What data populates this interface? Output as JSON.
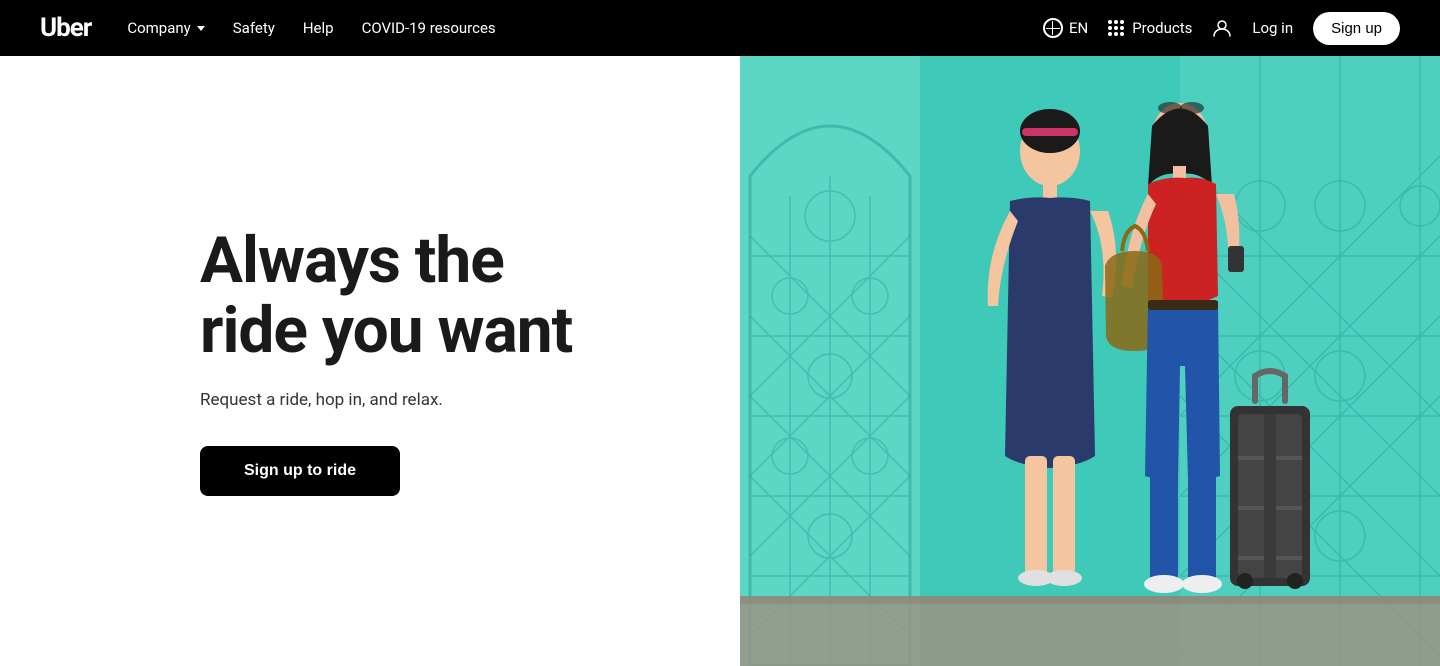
{
  "nav": {
    "logo": "Uber",
    "links": [
      {
        "label": "Company",
        "hasDropdown": true
      },
      {
        "label": "Safety",
        "hasDropdown": false
      },
      {
        "label": "Help",
        "hasDropdown": false
      },
      {
        "label": "COVID-19 resources",
        "hasDropdown": false
      }
    ],
    "lang": "EN",
    "products_label": "Products",
    "login_label": "Log in",
    "signup_label": "Sign up"
  },
  "hero": {
    "title": "Always the ride you want",
    "subtitle": "Request a ride, hop in, and relax.",
    "cta_label": "Sign up to ride"
  }
}
